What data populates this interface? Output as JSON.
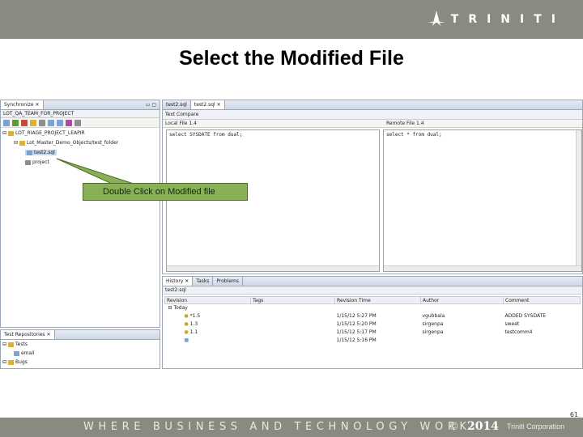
{
  "brand": {
    "logo_text": "TRINITI"
  },
  "title": "Select the Modified File",
  "synchronize_view": {
    "tab_label": "Synchronize",
    "header": "LOT_QA_TEAM_FOR_PROJECT",
    "tree": [
      "LOT_RIAGE_PROJECT_LEAPIR",
      "Lot_Master_Demo_Objects/test_folder",
      "test2.sql",
      "project"
    ]
  },
  "editor": {
    "tabs": [
      "test2.sql",
      "test2.sql"
    ],
    "compare_header": "Text Compare",
    "left_label": "Local File 1.4",
    "right_label": "Remote File 1.4",
    "left_code": "select SYSDATE from dual;",
    "right_code": "select * from dual;"
  },
  "history_view": {
    "tabs": [
      "History",
      "Tasks",
      "Problems"
    ],
    "file_label": "test2.sql",
    "columns": [
      "Revision",
      "Tags",
      "Revision Time",
      "Author",
      "Comment"
    ],
    "group_label": "Today",
    "rows": [
      {
        "revision": "*1.5",
        "tags": "",
        "time": "1/15/12 5:27 PM",
        "author": "vgubbala",
        "comment": "ADDED SYSDATE"
      },
      {
        "revision": "1.3",
        "tags": "",
        "time": "1/15/12 5:20 PM",
        "author": "sirgenpa",
        "comment": "sweet"
      },
      {
        "revision": "1.1",
        "tags": "",
        "time": "1/15/12 5:17 PM",
        "author": "sirgenpa",
        "comment": "testcomm4"
      },
      {
        "revision": "",
        "tags": "",
        "time": "1/15/12 5:16 PM",
        "author": "",
        "comment": ""
      }
    ]
  },
  "repositories_view": {
    "tab_label": "Test Repositories",
    "tree": [
      "Tests",
      "email",
      "Bugs"
    ]
  },
  "callout": {
    "text": "Double Click on  Modified file"
  },
  "page_number": "61",
  "footer": {
    "tagline": "WHERE BUSINESS AND TECHNOLOGY WORK",
    "copyright_symbol": "©",
    "year": "2014",
    "company": "Triniti Corporation"
  },
  "colors": {
    "banner": "#8a8a80",
    "callout_fill": "#88b054",
    "callout_border": "#4d6b2a"
  }
}
